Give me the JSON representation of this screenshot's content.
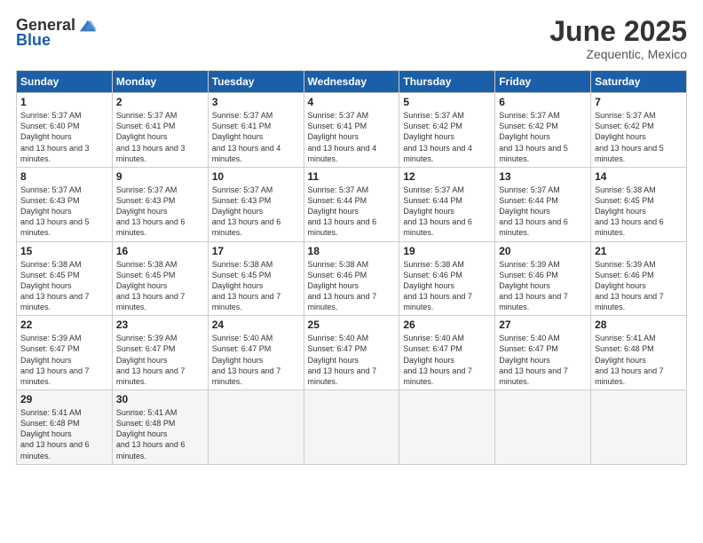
{
  "logo": {
    "general": "General",
    "blue": "Blue"
  },
  "title": {
    "month": "June 2025",
    "location": "Zequentic, Mexico"
  },
  "headers": [
    "Sunday",
    "Monday",
    "Tuesday",
    "Wednesday",
    "Thursday",
    "Friday",
    "Saturday"
  ],
  "weeks": [
    [
      {
        "day": "1",
        "sunrise": "5:37 AM",
        "sunset": "6:40 PM",
        "daylight": "13 hours and 3 minutes."
      },
      {
        "day": "2",
        "sunrise": "5:37 AM",
        "sunset": "6:41 PM",
        "daylight": "13 hours and 3 minutes."
      },
      {
        "day": "3",
        "sunrise": "5:37 AM",
        "sunset": "6:41 PM",
        "daylight": "13 hours and 4 minutes."
      },
      {
        "day": "4",
        "sunrise": "5:37 AM",
        "sunset": "6:41 PM",
        "daylight": "13 hours and 4 minutes."
      },
      {
        "day": "5",
        "sunrise": "5:37 AM",
        "sunset": "6:42 PM",
        "daylight": "13 hours and 4 minutes."
      },
      {
        "day": "6",
        "sunrise": "5:37 AM",
        "sunset": "6:42 PM",
        "daylight": "13 hours and 5 minutes."
      },
      {
        "day": "7",
        "sunrise": "5:37 AM",
        "sunset": "6:42 PM",
        "daylight": "13 hours and 5 minutes."
      }
    ],
    [
      {
        "day": "8",
        "sunrise": "5:37 AM",
        "sunset": "6:43 PM",
        "daylight": "13 hours and 5 minutes."
      },
      {
        "day": "9",
        "sunrise": "5:37 AM",
        "sunset": "6:43 PM",
        "daylight": "13 hours and 6 minutes."
      },
      {
        "day": "10",
        "sunrise": "5:37 AM",
        "sunset": "6:43 PM",
        "daylight": "13 hours and 6 minutes."
      },
      {
        "day": "11",
        "sunrise": "5:37 AM",
        "sunset": "6:44 PM",
        "daylight": "13 hours and 6 minutes."
      },
      {
        "day": "12",
        "sunrise": "5:37 AM",
        "sunset": "6:44 PM",
        "daylight": "13 hours and 6 minutes."
      },
      {
        "day": "13",
        "sunrise": "5:37 AM",
        "sunset": "6:44 PM",
        "daylight": "13 hours and 6 minutes."
      },
      {
        "day": "14",
        "sunrise": "5:38 AM",
        "sunset": "6:45 PM",
        "daylight": "13 hours and 6 minutes."
      }
    ],
    [
      {
        "day": "15",
        "sunrise": "5:38 AM",
        "sunset": "6:45 PM",
        "daylight": "13 hours and 7 minutes."
      },
      {
        "day": "16",
        "sunrise": "5:38 AM",
        "sunset": "6:45 PM",
        "daylight": "13 hours and 7 minutes."
      },
      {
        "day": "17",
        "sunrise": "5:38 AM",
        "sunset": "6:45 PM",
        "daylight": "13 hours and 7 minutes."
      },
      {
        "day": "18",
        "sunrise": "5:38 AM",
        "sunset": "6:46 PM",
        "daylight": "13 hours and 7 minutes."
      },
      {
        "day": "19",
        "sunrise": "5:38 AM",
        "sunset": "6:46 PM",
        "daylight": "13 hours and 7 minutes."
      },
      {
        "day": "20",
        "sunrise": "5:39 AM",
        "sunset": "6:46 PM",
        "daylight": "13 hours and 7 minutes."
      },
      {
        "day": "21",
        "sunrise": "5:39 AM",
        "sunset": "6:46 PM",
        "daylight": "13 hours and 7 minutes."
      }
    ],
    [
      {
        "day": "22",
        "sunrise": "5:39 AM",
        "sunset": "6:47 PM",
        "daylight": "13 hours and 7 minutes."
      },
      {
        "day": "23",
        "sunrise": "5:39 AM",
        "sunset": "6:47 PM",
        "daylight": "13 hours and 7 minutes."
      },
      {
        "day": "24",
        "sunrise": "5:40 AM",
        "sunset": "6:47 PM",
        "daylight": "13 hours and 7 minutes."
      },
      {
        "day": "25",
        "sunrise": "5:40 AM",
        "sunset": "6:47 PM",
        "daylight": "13 hours and 7 minutes."
      },
      {
        "day": "26",
        "sunrise": "5:40 AM",
        "sunset": "6:47 PM",
        "daylight": "13 hours and 7 minutes."
      },
      {
        "day": "27",
        "sunrise": "5:40 AM",
        "sunset": "6:47 PM",
        "daylight": "13 hours and 7 minutes."
      },
      {
        "day": "28",
        "sunrise": "5:41 AM",
        "sunset": "6:48 PM",
        "daylight": "13 hours and 7 minutes."
      }
    ],
    [
      {
        "day": "29",
        "sunrise": "5:41 AM",
        "sunset": "6:48 PM",
        "daylight": "13 hours and 6 minutes."
      },
      {
        "day": "30",
        "sunrise": "5:41 AM",
        "sunset": "6:48 PM",
        "daylight": "13 hours and 6 minutes."
      },
      {
        "day": "",
        "sunrise": "",
        "sunset": "",
        "daylight": ""
      },
      {
        "day": "",
        "sunrise": "",
        "sunset": "",
        "daylight": ""
      },
      {
        "day": "",
        "sunrise": "",
        "sunset": "",
        "daylight": ""
      },
      {
        "day": "",
        "sunrise": "",
        "sunset": "",
        "daylight": ""
      },
      {
        "day": "",
        "sunrise": "",
        "sunset": "",
        "daylight": ""
      }
    ]
  ],
  "labels": {
    "sunrise": "Sunrise:",
    "sunset": "Sunset:",
    "daylight": "Daylight hours"
  }
}
